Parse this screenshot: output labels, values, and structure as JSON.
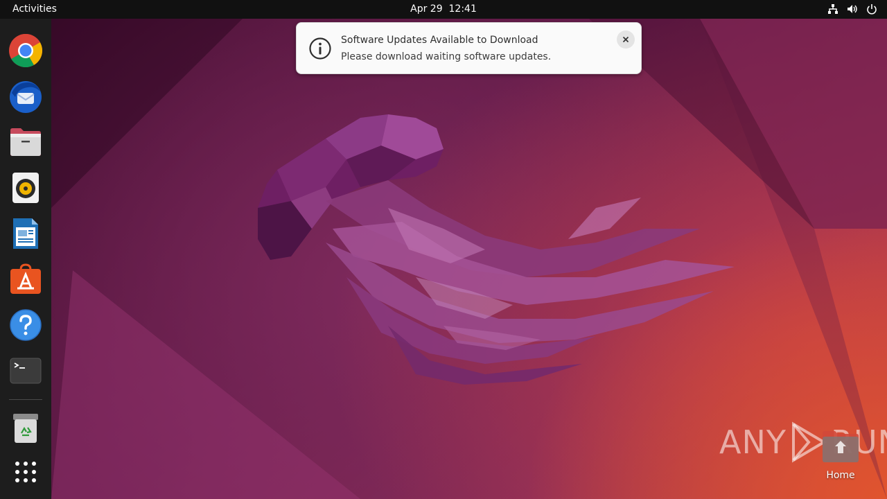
{
  "topbar": {
    "activities": "Activities",
    "date": "Apr 29",
    "time": "12:41",
    "tray_icons": [
      "network-icon",
      "volume-icon",
      "power-icon"
    ]
  },
  "dock": {
    "apps": [
      {
        "name": "Chrome",
        "icon": "chrome-icon"
      },
      {
        "name": "Thunderbird",
        "icon": "thunderbird-icon"
      },
      {
        "name": "Files",
        "icon": "files-icon"
      },
      {
        "name": "Rhythmbox",
        "icon": "rhythmbox-icon"
      },
      {
        "name": "LibreOffice Writer",
        "icon": "writer-icon"
      },
      {
        "name": "Ubuntu Software",
        "icon": "software-center-icon"
      },
      {
        "name": "Help",
        "icon": "help-icon"
      },
      {
        "name": "Terminal",
        "icon": "terminal-icon"
      },
      {
        "name": "Trash",
        "icon": "trash-icon"
      },
      {
        "name": "Show Applications",
        "icon": "app-grid-icon"
      }
    ]
  },
  "notification": {
    "title": "Software Updates Available to Download",
    "body": "Please download waiting software updates.",
    "icon": "info-icon"
  },
  "desktop": {
    "home_label": "Home"
  },
  "watermark": {
    "left": "ANY",
    "right": "RUN"
  },
  "colors": {
    "topbar": "#111111",
    "dock": "#1d1d1d",
    "notification_bg": "#fafafa",
    "wallpaper_dark": "#3a0a2a",
    "wallpaper_accent": "#e0542e"
  }
}
